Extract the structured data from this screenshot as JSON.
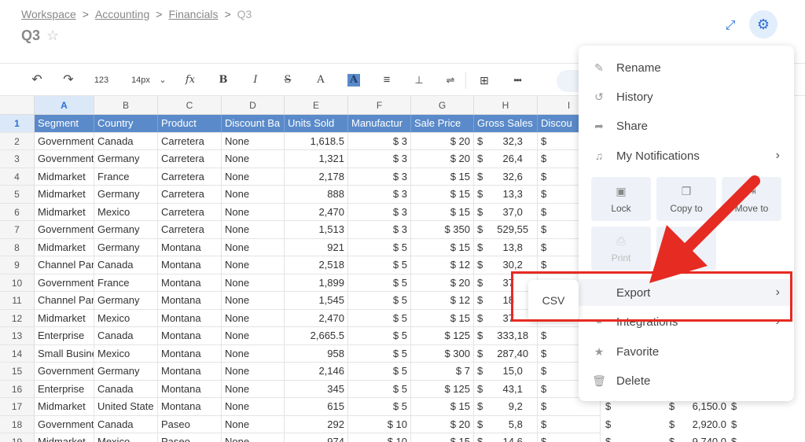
{
  "breadcrumb": {
    "items": [
      "Workspace",
      "Accounting",
      "Financials"
    ],
    "current": "Q3",
    "sep": ">"
  },
  "sheet_title": "Q3",
  "toolbar": {
    "undo": "↶",
    "redo": "↷",
    "format_number": "123",
    "font_size": "14px",
    "function": "fx",
    "bold": "B",
    "italic": "I",
    "strike": "S",
    "text_color": "A",
    "fill_color": "A",
    "align": "≡",
    "valign": "⊥",
    "wrap": "⇌",
    "more": "•••"
  },
  "columns": [
    "A",
    "B",
    "C",
    "D",
    "E",
    "F",
    "G",
    "H",
    "I"
  ],
  "header_row": [
    "Segment",
    "Country",
    "Product",
    "Discount Ba",
    "Units Sold",
    "Manufactur",
    "Sale Price",
    "Gross Sales",
    "Discou"
  ],
  "rows": [
    {
      "n": "2",
      "cells": [
        "Government",
        "Canada",
        "Carretera",
        "None",
        "1,618.5",
        "$ 3",
        "$ 20",
        "$       32,3",
        "$"
      ]
    },
    {
      "n": "3",
      "cells": [
        "Government",
        "Germany",
        "Carretera",
        "None",
        "1,321",
        "$ 3",
        "$ 20",
        "$       26,4",
        "$"
      ]
    },
    {
      "n": "4",
      "cells": [
        "Midmarket",
        "France",
        "Carretera",
        "None",
        "2,178",
        "$ 3",
        "$ 15",
        "$       32,6",
        "$"
      ]
    },
    {
      "n": "5",
      "cells": [
        "Midmarket",
        "Germany",
        "Carretera",
        "None",
        "888",
        "$ 3",
        "$ 15",
        "$       13,3",
        "$"
      ]
    },
    {
      "n": "6",
      "cells": [
        "Midmarket",
        "Mexico",
        "Carretera",
        "None",
        "2,470",
        "$ 3",
        "$ 15",
        "$       37,0",
        "$"
      ]
    },
    {
      "n": "7",
      "cells": [
        "Government",
        "Germany",
        "Carretera",
        "None",
        "1,513",
        "$ 3",
        "$ 350",
        "$     529,55",
        "$"
      ]
    },
    {
      "n": "8",
      "cells": [
        "Midmarket",
        "Germany",
        "Montana",
        "None",
        "921",
        "$ 5",
        "$ 15",
        "$       13,8",
        "$"
      ]
    },
    {
      "n": "9",
      "cells": [
        "Channel Par",
        "Canada",
        "Montana",
        "None",
        "2,518",
        "$ 5",
        "$ 12",
        "$       30,2",
        "$"
      ]
    },
    {
      "n": "10",
      "cells": [
        "Government",
        "France",
        "Montana",
        "None",
        "1,899",
        "$ 5",
        "$ 20",
        "$       37",
        ""
      ]
    },
    {
      "n": "11",
      "cells": [
        "Channel Par",
        "Germany",
        "Montana",
        "None",
        "1,545",
        "$ 5",
        "$ 12",
        "$       18",
        ""
      ]
    },
    {
      "n": "12",
      "cells": [
        "Midmarket",
        "Mexico",
        "Montana",
        "None",
        "2,470",
        "$ 5",
        "$ 15",
        "$       37",
        ""
      ]
    },
    {
      "n": "13",
      "cells": [
        "Enterprise",
        "Canada",
        "Montana",
        "None",
        "2,665.5",
        "$ 5",
        "$ 125",
        "$     333,18",
        "$"
      ]
    },
    {
      "n": "14",
      "cells": [
        "Small Busine",
        "Mexico",
        "Montana",
        "None",
        "958",
        "$ 5",
        "$ 300",
        "$     287,40",
        "$"
      ]
    },
    {
      "n": "15",
      "cells": [
        "Government",
        "Germany",
        "Montana",
        "None",
        "2,146",
        "$ 5",
        "$ 7",
        "$       15,0",
        "$"
      ]
    },
    {
      "n": "16",
      "cells": [
        "Enterprise",
        "Canada",
        "Montana",
        "None",
        "345",
        "$ 5",
        "$ 125",
        "$       43,1",
        "$"
      ]
    },
    {
      "n": "17",
      "cells": [
        "Midmarket",
        "United State",
        "Montana",
        "None",
        "615",
        "$ 5",
        "$ 15",
        "$         9,2",
        "$"
      ]
    },
    {
      "n": "18",
      "cells": [
        "Government",
        "Canada",
        "Paseo",
        "None",
        "292",
        "$ 10",
        "$ 20",
        "$         5,8",
        "$"
      ]
    },
    {
      "n": "19",
      "cells": [
        "Midmarket",
        "Mexico",
        "Paseo",
        "None",
        "974",
        "$ 10",
        "$ 15",
        "$       14,6",
        "$"
      ]
    }
  ],
  "peek_cells": [
    {
      "row": "17",
      "a": "$",
      "b": "$",
      "c": "6,150.0",
      "d": "$"
    },
    {
      "row": "18",
      "a": "$",
      "b": "$",
      "c": "2,920.0",
      "d": "$"
    },
    {
      "row": "19",
      "a": "$",
      "b": "$",
      "c": "9,740.0",
      "d": "$"
    }
  ],
  "menu": {
    "rename": "Rename",
    "history": "History",
    "share": "Share",
    "notifications": "My Notifications",
    "tiles": {
      "lock": "Lock",
      "copy": "Copy to",
      "move": "Move to",
      "print": "Print"
    },
    "export": "Export",
    "integrations": "Integrations",
    "favorite": "Favorite",
    "delete": "Delete"
  },
  "submenu": {
    "csv": "CSV"
  },
  "colors": {
    "accent": "#2a6fd6",
    "header_fill": "#5a8ac9",
    "annotation_red": "#e62b22"
  }
}
